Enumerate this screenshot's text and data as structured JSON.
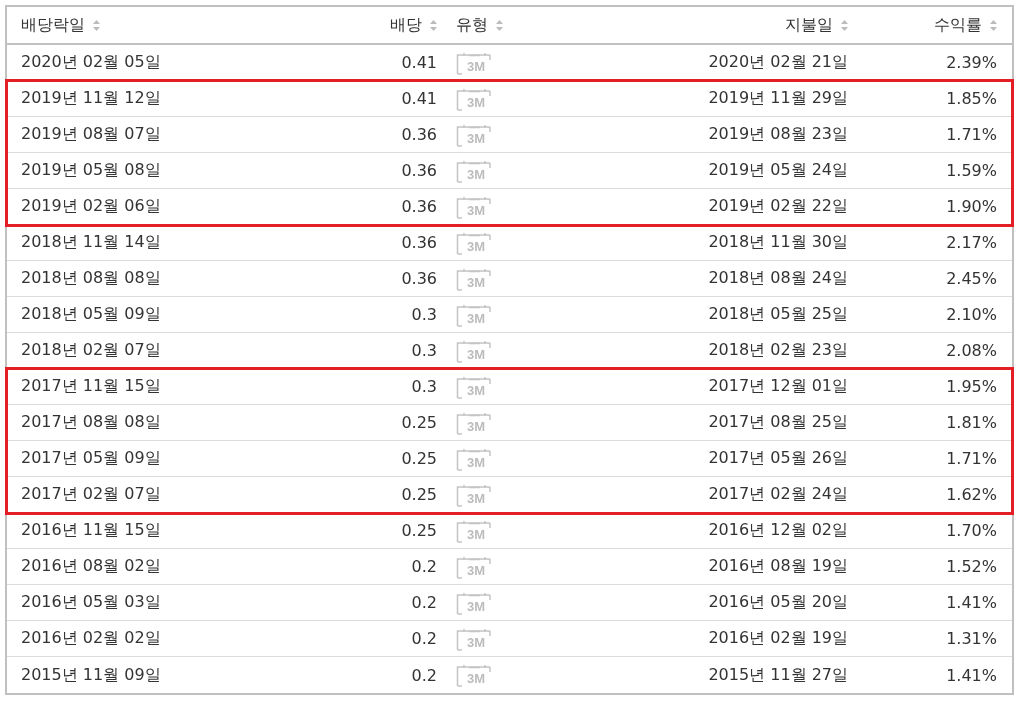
{
  "table": {
    "columns": [
      {
        "label": "배당락일"
      },
      {
        "label": "배당"
      },
      {
        "label": "유형"
      },
      {
        "label": "지불일"
      },
      {
        "label": "수익률"
      }
    ],
    "sections": [
      {
        "highlighted": false,
        "rows": [
          {
            "ex_date": "2020년 02월 05일",
            "dividend": "0.41",
            "type": "3M",
            "pay_date": "2020년 02월 21일",
            "yield": "2.39%"
          }
        ]
      },
      {
        "highlighted": true,
        "rows": [
          {
            "ex_date": "2019년 11월 12일",
            "dividend": "0.41",
            "type": "3M",
            "pay_date": "2019년 11월 29일",
            "yield": "1.85%"
          },
          {
            "ex_date": "2019년 08월 07일",
            "dividend": "0.36",
            "type": "3M",
            "pay_date": "2019년 08월 23일",
            "yield": "1.71%"
          },
          {
            "ex_date": "2019년 05월 08일",
            "dividend": "0.36",
            "type": "3M",
            "pay_date": "2019년 05월 24일",
            "yield": "1.59%"
          },
          {
            "ex_date": "2019년 02월 06일",
            "dividend": "0.36",
            "type": "3M",
            "pay_date": "2019년 02월 22일",
            "yield": "1.90%"
          }
        ]
      },
      {
        "highlighted": false,
        "rows": [
          {
            "ex_date": "2018년 11월 14일",
            "dividend": "0.36",
            "type": "3M",
            "pay_date": "2018년 11월 30일",
            "yield": "2.17%"
          },
          {
            "ex_date": "2018년 08월 08일",
            "dividend": "0.36",
            "type": "3M",
            "pay_date": "2018년 08월 24일",
            "yield": "2.45%"
          },
          {
            "ex_date": "2018년 05월 09일",
            "dividend": "0.3",
            "type": "3M",
            "pay_date": "2018년 05월 25일",
            "yield": "2.10%"
          },
          {
            "ex_date": "2018년 02월 07일",
            "dividend": "0.3",
            "type": "3M",
            "pay_date": "2018년 02월 23일",
            "yield": "2.08%"
          }
        ]
      },
      {
        "highlighted": true,
        "rows": [
          {
            "ex_date": "2017년 11월 15일",
            "dividend": "0.3",
            "type": "3M",
            "pay_date": "2017년 12월 01일",
            "yield": "1.95%"
          },
          {
            "ex_date": "2017년 08월 08일",
            "dividend": "0.25",
            "type": "3M",
            "pay_date": "2017년 08월 25일",
            "yield": "1.81%"
          },
          {
            "ex_date": "2017년 05월 09일",
            "dividend": "0.25",
            "type": "3M",
            "pay_date": "2017년 05월 26일",
            "yield": "1.71%"
          },
          {
            "ex_date": "2017년 02월 07일",
            "dividend": "0.25",
            "type": "3M",
            "pay_date": "2017년 02월 24일",
            "yield": "1.62%"
          }
        ]
      },
      {
        "highlighted": false,
        "rows": [
          {
            "ex_date": "2016년 11월 15일",
            "dividend": "0.25",
            "type": "3M",
            "pay_date": "2016년 12월 02일",
            "yield": "1.70%"
          },
          {
            "ex_date": "2016년 08월 02일",
            "dividend": "0.2",
            "type": "3M",
            "pay_date": "2016년 08월 19일",
            "yield": "1.52%"
          },
          {
            "ex_date": "2016년 05월 03일",
            "dividend": "0.2",
            "type": "3M",
            "pay_date": "2016년 05월 20일",
            "yield": "1.41%"
          },
          {
            "ex_date": "2016년 02월 02일",
            "dividend": "0.2",
            "type": "3M",
            "pay_date": "2016년 02월 19일",
            "yield": "1.31%"
          },
          {
            "ex_date": "2015년 11월 09일",
            "dividend": "0.2",
            "type": "3M",
            "pay_date": "2015년 11월 27일",
            "yield": "1.41%"
          }
        ]
      }
    ]
  }
}
